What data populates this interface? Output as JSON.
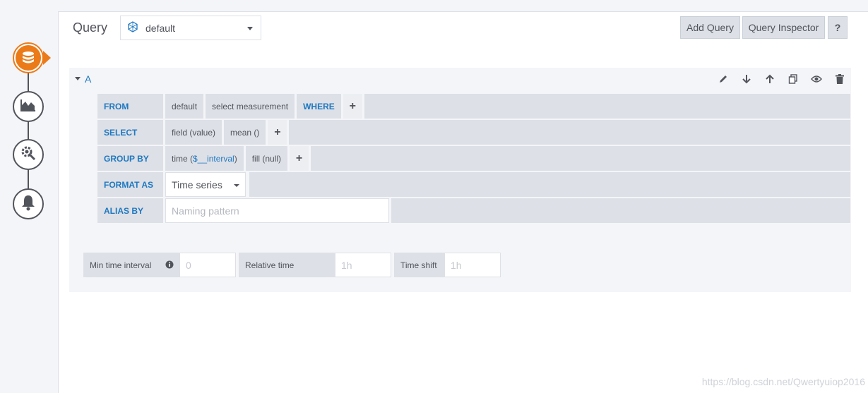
{
  "header": {
    "title": "Query",
    "datasource": "default",
    "add_query": "Add Query",
    "query_inspector": "Query Inspector",
    "help": "?"
  },
  "query": {
    "name": "A",
    "from_label": "FROM",
    "from_policy": "default",
    "from_measurement": "select measurement",
    "where_label": "WHERE",
    "select_label": "SELECT",
    "select_field": "field (value)",
    "select_func": "mean ()",
    "groupby_label": "GROUP BY",
    "groupby_time_prefix": "time (",
    "groupby_time_var": "$__interval",
    "groupby_time_suffix": ")",
    "groupby_fill": "fill (null)",
    "format_label": "FORMAT AS",
    "format_value": "Time series",
    "alias_label": "ALIAS BY",
    "alias_placeholder": "Naming pattern",
    "plus": "+"
  },
  "options": {
    "min_interval_label": "Min time interval",
    "min_interval_placeholder": "0",
    "relative_time_label": "Relative time",
    "relative_time_placeholder": "1h",
    "time_shift_label": "Time shift",
    "time_shift_placeholder": "1h"
  },
  "watermark": "https://blog.csdn.net/Qwertyuiop2016",
  "colors": {
    "accent": "#eb7b18",
    "link_blue": "#1f78c1",
    "segment_bg": "#dde0e6"
  }
}
